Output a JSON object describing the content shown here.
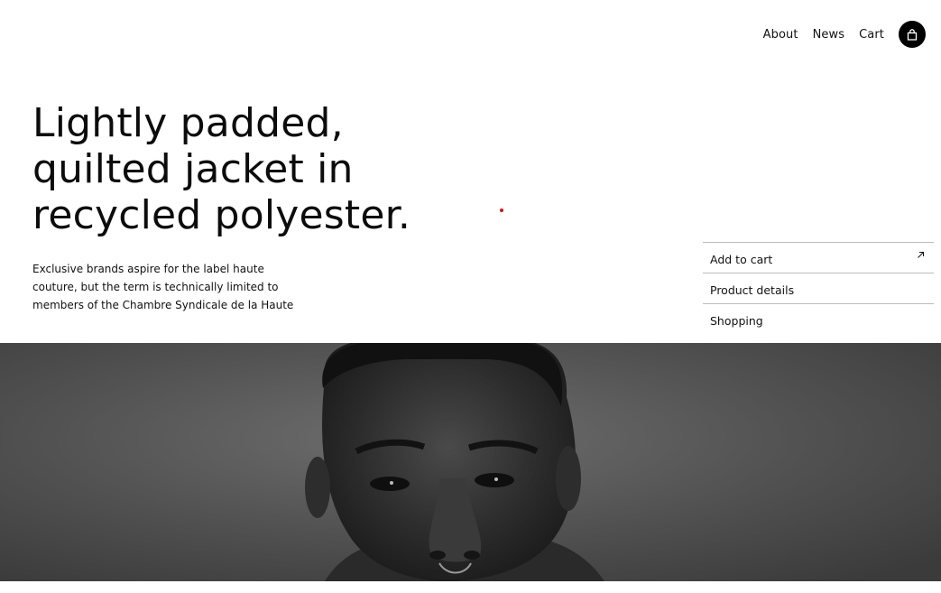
{
  "nav": {
    "links": [
      "About",
      "News",
      "Cart"
    ],
    "cart_icon": "shopping-bag-icon"
  },
  "hero": {
    "headline_lines": [
      "Lightly padded,",
      "quilted jacket in",
      "recycled polyester."
    ],
    "description_lines": [
      "Exclusive brands aspire for the label haute",
      "couture, but the term is technically limited to",
      "members of the Chambre Syndicale de la Haute"
    ]
  },
  "menu": {
    "items": [
      "Add to cart",
      "Product details",
      "Shopping"
    ],
    "add_icon": "arrow-up-right-icon"
  },
  "colors": {
    "accent_dot": "#e01010",
    "button_bg": "#000000"
  }
}
